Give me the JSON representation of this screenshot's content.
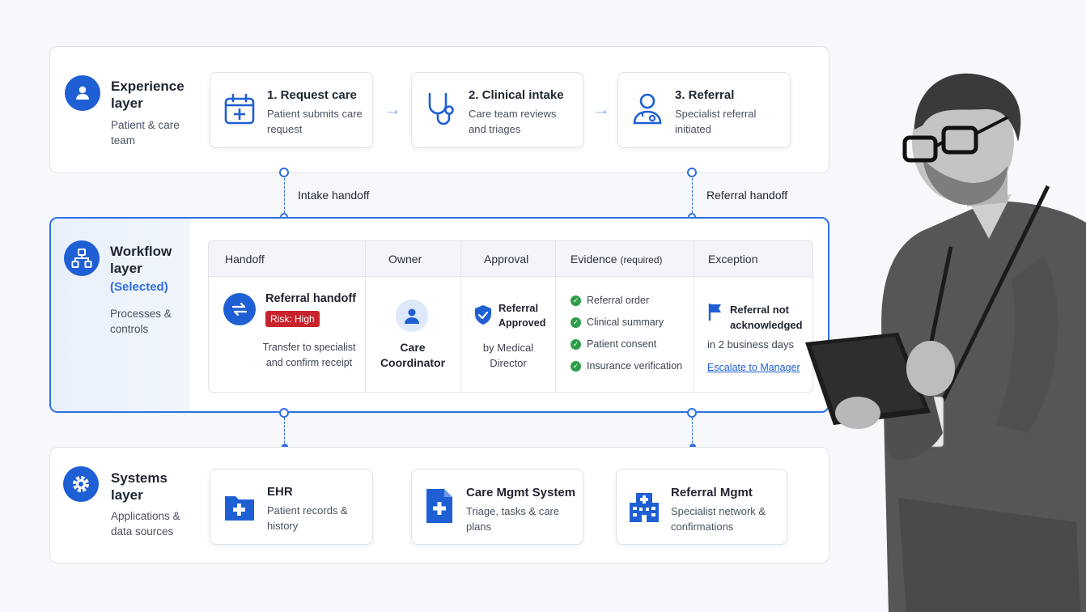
{
  "experience": {
    "title": "Experience layer",
    "subtitle": "Patient & care team",
    "steps": [
      {
        "title": "1. Request care",
        "desc": "Patient submits care request",
        "icon": "calendar-plus-icon"
      },
      {
        "title": "2. Clinical intake",
        "desc": "Care team reviews and triages",
        "icon": "stethoscope-icon"
      },
      {
        "title": "3. Referral",
        "desc": "Specialist referral initiated",
        "icon": "doctor-icon"
      }
    ]
  },
  "handoffs": {
    "intake": "Intake handoff",
    "referral": "Referral handoff"
  },
  "workflow": {
    "title": "Workflow layer",
    "selected": "(Selected)",
    "subtitle": "Processes & controls",
    "columns": {
      "handoff": "Handoff",
      "owner": "Owner",
      "approval": "Approval",
      "evidence": "Evidence",
      "evidence_note": "(required)",
      "exception": "Exception"
    },
    "row": {
      "handoff_name": "Referral handoff",
      "risk": "Risk: High",
      "handoff_desc": "Transfer to specialist and confirm receipt",
      "owner": "Care Coordinator",
      "approval_title": "Referral",
      "approval_status": "Approved",
      "approval_by": "by Medical Director",
      "evidence": [
        "Referral order",
        "Clinical summary",
        "Patient consent",
        "Insurance verification"
      ],
      "exception_title": "Referral not acknowledged",
      "exception_desc": "in 2 business days",
      "exception_action": "Escalate to Manager"
    }
  },
  "systems": {
    "title": "Systems layer",
    "subtitle": "Applications & data sources",
    "items": [
      {
        "title": "EHR",
        "desc": "Patient records & history",
        "icon": "medical-folder-icon"
      },
      {
        "title": "Care Mgmt System",
        "desc": "Triage, tasks & care plans",
        "icon": "medical-document-icon"
      },
      {
        "title": "Referral Mgmt",
        "desc": "Specialist network & confirmations",
        "icon": "hospital-icon"
      }
    ]
  },
  "colors": {
    "accent": "#1f5fd4",
    "selected_border": "#2f6fe0",
    "risk": "#c8232c",
    "check": "#2e9d4a"
  }
}
